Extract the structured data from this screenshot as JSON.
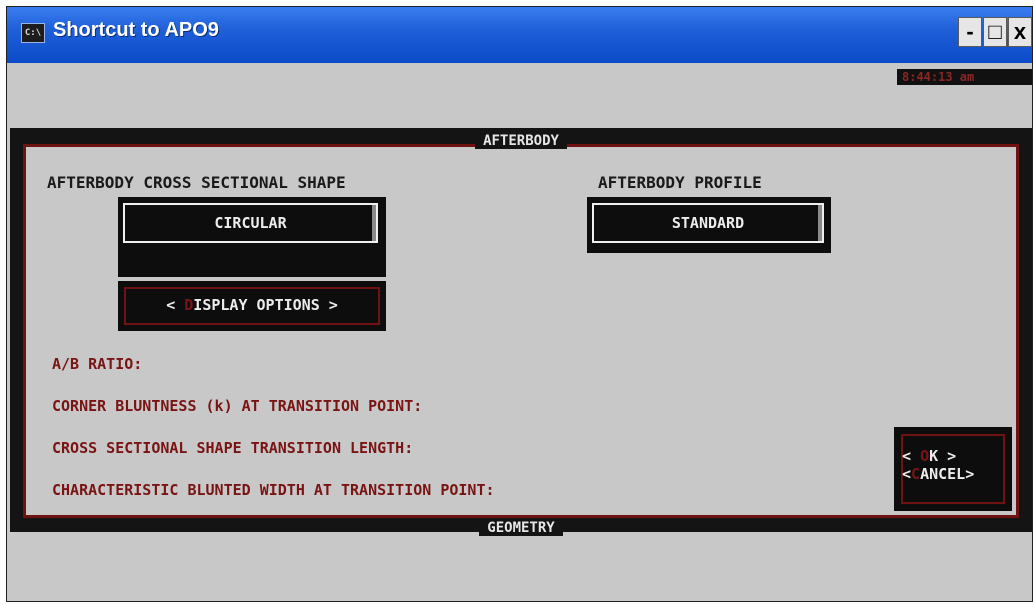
{
  "window": {
    "title": "Shortcut to APO9",
    "icon_text": "C:\\",
    "icon": "console-icon",
    "controls": {
      "minimize": "-",
      "maximize": "□",
      "close": "x"
    }
  },
  "clock": "8:44:13 am",
  "frame": {
    "top_title": "AFTERBODY",
    "bottom_title": "GEOMETRY"
  },
  "cross_section": {
    "label": "AFTERBODY CROSS SECTIONAL SHAPE",
    "value": "CIRCULAR"
  },
  "profile": {
    "label": "AFTERBODY PROFILE",
    "value": "STANDARD"
  },
  "display_options": {
    "prefix": "< ",
    "hotkey": "D",
    "rest": "ISPLAY OPTIONS >"
  },
  "params": [
    "A/B RATIO:",
    "CORNER BLUNTNESS (k) AT TRANSITION POINT:",
    "CROSS SECTIONAL SHAPE TRANSITION LENGTH:",
    "CHARACTERISTIC BLUNTED WIDTH AT TRANSITION POINT:"
  ],
  "ok_button": {
    "prefix": "< ",
    "hotkey": "O",
    "rest": "K  >"
  },
  "cancel_button": {
    "prefix": "<",
    "hotkey": "C",
    "rest": "ANCEL>"
  },
  "colors": {
    "accent_red": "#7a1414",
    "panel_gray": "#c8c8c8",
    "titlebar_blue": "#1f5fd8"
  }
}
